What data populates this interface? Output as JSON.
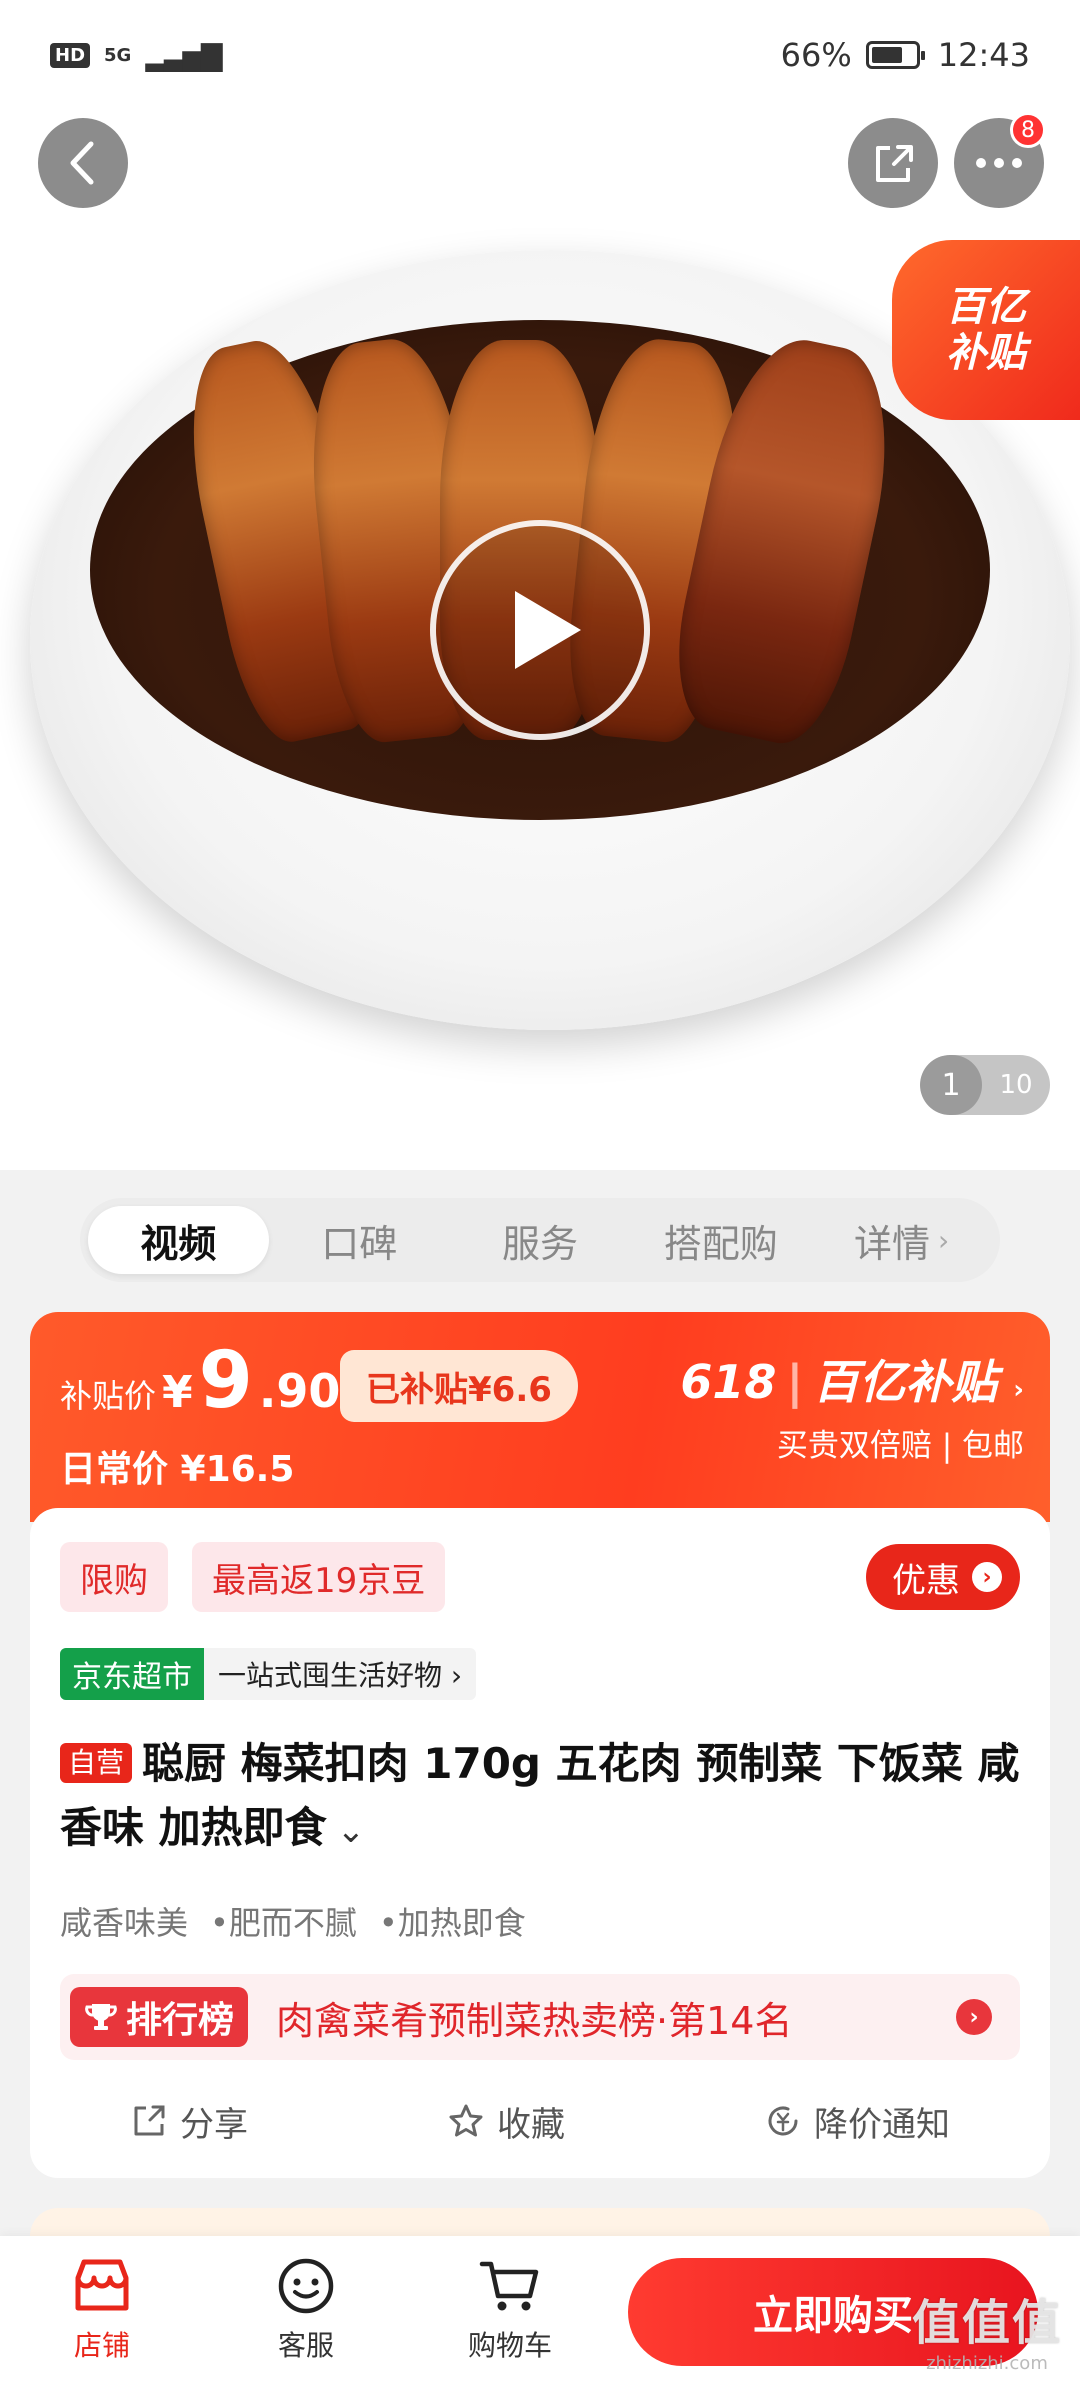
{
  "status_bar": {
    "hd": "HD",
    "network": "5G",
    "battery": "66%",
    "time": "12:43"
  },
  "hero": {
    "more_badge": "8",
    "subsidy_badge_line1": "百亿",
    "subsidy_badge_line2": "补贴",
    "pager_current": "1",
    "pager_total": "10"
  },
  "tabs": [
    {
      "label": "视频",
      "active": true
    },
    {
      "label": "口碑"
    },
    {
      "label": "服务"
    },
    {
      "label": "搭配购"
    },
    {
      "label": "详情"
    }
  ],
  "price": {
    "label": "补贴价",
    "yen": "¥",
    "integer": "9",
    "decimal": ".90",
    "subsidized": "已补贴¥6.6",
    "daily_label": "日常价 ¥16.5",
    "promo_618": "618",
    "promo_brand": "百亿补贴",
    "promo_desc": "买贵双倍赔 | 包邮"
  },
  "info": {
    "chip_limit": "限购",
    "chip_bean": "最高返19京豆",
    "youhui": "优惠",
    "jd_tag": "京东超市",
    "jd_text": "一站式囤生活好物 ›",
    "self_tag": "自营",
    "title": "聪厨 梅菜扣肉 170g 五花肉 预制菜 下饭菜  咸香味 加热即食",
    "features": [
      "咸香味美",
      "•肥而不腻",
      "•加热即食"
    ],
    "rank_tag": "排行榜",
    "rank_text": "肉禽菜肴预制菜热卖榜·第14名",
    "actions": {
      "share": "分享",
      "favorite": "收藏",
      "price_alert": "降价通知"
    }
  },
  "bottom_bar": {
    "shop": "店铺",
    "service": "客服",
    "cart": "购物车",
    "buy": "立即购买"
  },
  "watermark": {
    "main": "值值值",
    "sub": "zhizhizhi.com"
  },
  "colors": {
    "accent_red": "#e8261a",
    "subsidy_orange": "#ff5a2a",
    "jd_green": "#14a04a"
  }
}
